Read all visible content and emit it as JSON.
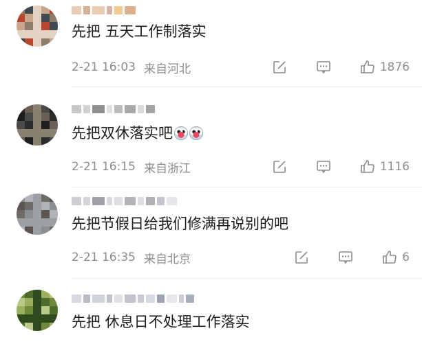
{
  "comments": [
    {
      "content": "先把 五天工作制落实",
      "time": "2-21 16:03",
      "location": "来自河北",
      "likes": "1876",
      "emoji_count": 0,
      "avatar_colors": [
        "#8f7b6a",
        "#c9a58b",
        "#3f4a52",
        "#b7462f",
        "#e2d2c2"
      ],
      "nick_colors": [
        "#d8a37a",
        "#c98f6a",
        "#e6c2a8",
        "#b77a55",
        "#f0b35e"
      ]
    },
    {
      "content": "先把双休落实吧",
      "time": "2-21 16:15",
      "location": "来自浙江",
      "likes": "1116",
      "emoji_count": 2,
      "avatar_colors": [
        "#2b2b2b",
        "#4a4a48",
        "#6a5f55",
        "#1e1e1e",
        "#8a8070"
      ],
      "nick_colors": [
        "#9a9a9a",
        "#bdbdbd",
        "#7d7d7d",
        "#c8c8c8",
        "#a0a0a0"
      ]
    },
    {
      "content": "先把节假日给我们修满再说别的吧",
      "time": "2-21 16:35",
      "location": "来自北京",
      "likes": "6",
      "emoji_count": 0,
      "avatar_colors": [
        "#8a8f94",
        "#6e6a66",
        "#b0b4b8",
        "#5a5550",
        "#9aa0a4"
      ],
      "nick_colors": [
        "#a6a6ad",
        "#c3c3cc",
        "#8f8f99",
        "#b9b9c4",
        "#d0d0d8"
      ]
    },
    {
      "content": "先把 休息日不处理工作落实",
      "time": "",
      "location": "",
      "likes": "",
      "emoji_count": 0,
      "avatar_colors": [
        "#6f8a3c",
        "#9bb05d",
        "#4d6b2a",
        "#b9c98a",
        "#2f4a1e"
      ],
      "nick_colors": [
        "#b8b8c8",
        "#9aa0b0",
        "#c9ccd6",
        "#8d93a3",
        "#d4d6de"
      ]
    }
  ],
  "icons": {
    "forward": "share-square-icon",
    "reply": "comment-bubble-icon",
    "like": "thumbs-up-icon"
  }
}
